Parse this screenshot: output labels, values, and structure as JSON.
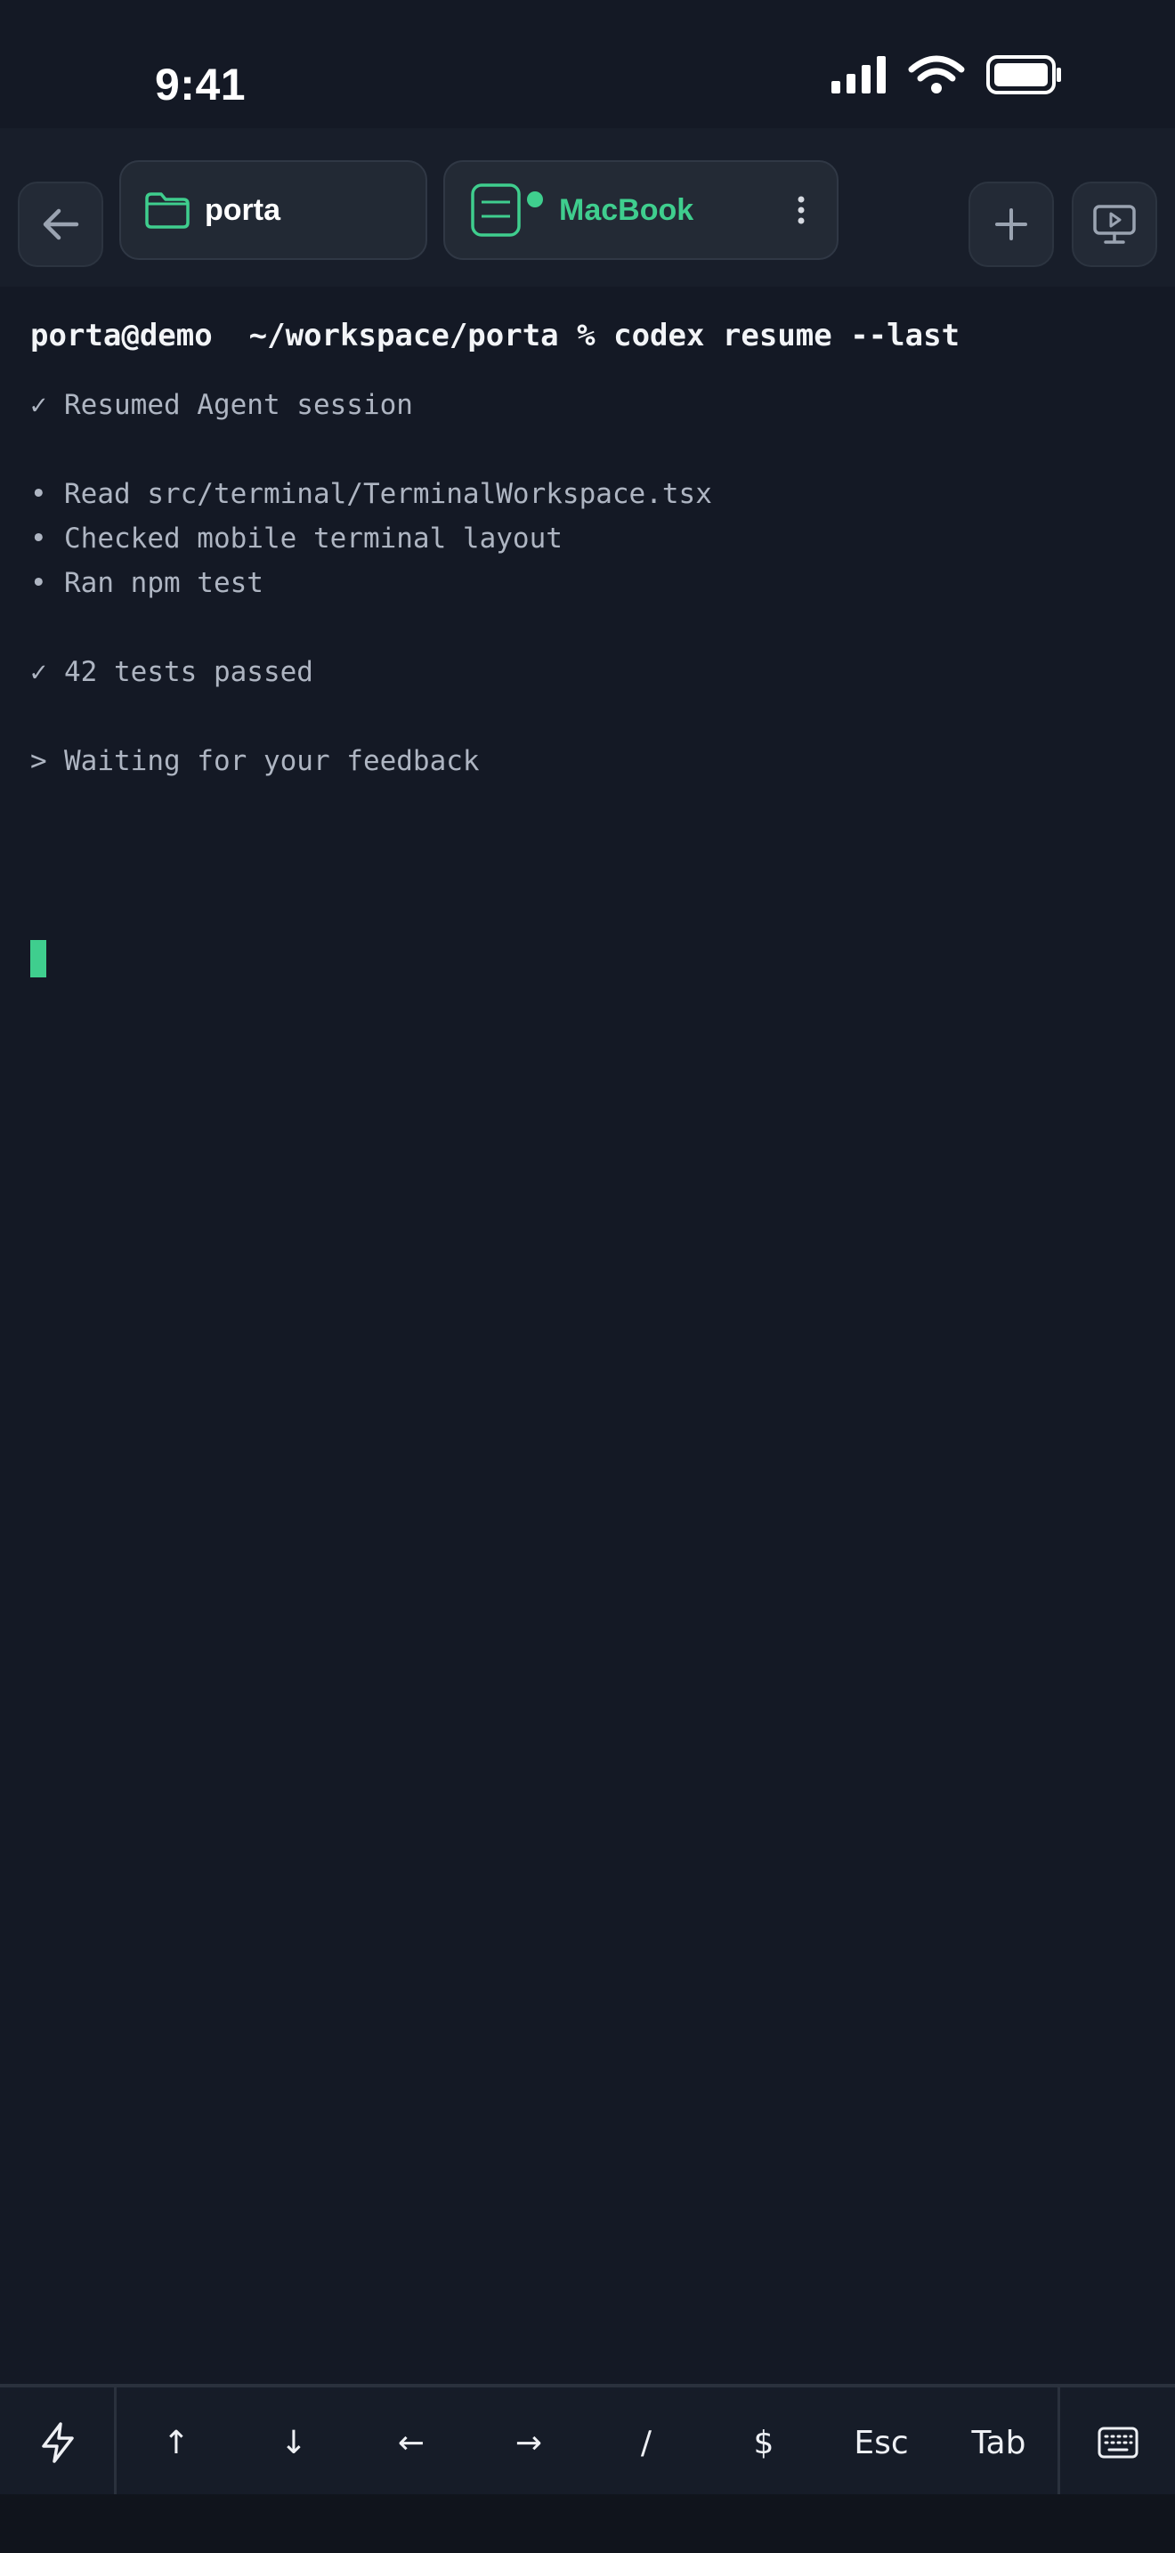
{
  "status": {
    "time": "9:41"
  },
  "tabs": [
    {
      "label": "porta",
      "icon": "folder-icon",
      "color": "#3fce8e"
    },
    {
      "label": "MacBook",
      "icon": "terminal-window-icon",
      "color": "#3fce8e",
      "online": true
    }
  ],
  "terminal": {
    "prompt_user": "porta@demo",
    "prompt_path": "~/workspace/porta",
    "prompt_symbol": "%",
    "command": "codex resume --last",
    "lines": [
      {
        "glyph": "✓",
        "text": "Resumed Agent session"
      },
      {
        "glyph": "",
        "text": ""
      },
      {
        "glyph": "•",
        "text": "Read src/terminal/TerminalWorkspace.tsx"
      },
      {
        "glyph": "•",
        "text": "Checked mobile terminal layout"
      },
      {
        "glyph": "•",
        "text": "Ran npm test"
      },
      {
        "glyph": "",
        "text": ""
      },
      {
        "glyph": "✓",
        "text": "42 tests passed"
      },
      {
        "glyph": "",
        "text": ""
      },
      {
        "glyph": ">",
        "text": "Waiting for your feedback"
      }
    ],
    "cursor_color": "#3fce8e"
  },
  "keys": {
    "up": "↑",
    "down": "↓",
    "left": "←",
    "right": "→",
    "slash": "/",
    "dollar": "$",
    "esc": "Esc",
    "tab": "Tab"
  },
  "colors": {
    "background": "#141925",
    "accent": "#3fce8e"
  }
}
